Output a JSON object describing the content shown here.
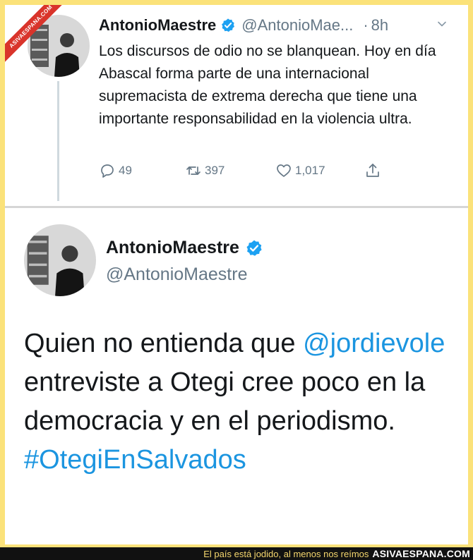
{
  "watermark": {
    "ribbon_text": "ASIVAESPANA.COM"
  },
  "tweet_reply": {
    "author_name": "AntonioMaestre",
    "handle": "@AntonioMae...",
    "separator": "·",
    "time": "8h",
    "text": "Los discursos de odio no se blanquean. Hoy en día Abascal forma parte de una internacional supremacista de extrema derecha que tiene una importante responsabilidad en la violencia ultra.",
    "reply_count": "49",
    "retweet_count": "397",
    "like_count": "1,017"
  },
  "tweet_original": {
    "author_name": "AntonioMaestre",
    "handle": "@AntonioMaestre",
    "text_before_mention": "Quien no entienda que ",
    "mention": "@jordievole",
    "text_after_mention": " entreviste a Otegi cree poco en la democracia y en el periodismo. ",
    "hashtag": "#OtegiEnSalvados"
  },
  "footer": {
    "caption": "El país está jodido, al menos nos reímos",
    "brand": "ASIVAESPANA.COM"
  },
  "colors": {
    "border": "#fbe27a",
    "link": "#1b95e0",
    "verified": "#1da1f2",
    "muted": "#657786",
    "ribbon": "#d9342b"
  }
}
